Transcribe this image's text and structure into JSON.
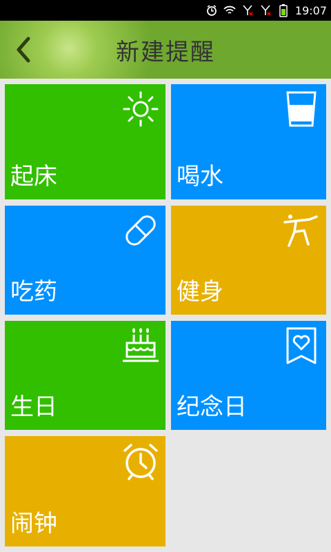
{
  "status": {
    "time": "19:07",
    "icons": [
      "alarm-icon",
      "wifi-icon",
      "signal-1-icon",
      "signal-2-icon",
      "battery-icon"
    ]
  },
  "header": {
    "title": "新建提醒",
    "back_icon": "chevron-left-icon"
  },
  "tiles": [
    {
      "label": "起床",
      "icon": "sun-icon",
      "color": "#31bf00"
    },
    {
      "label": "喝水",
      "icon": "cup-icon",
      "color": "#0091ff"
    },
    {
      "label": "吃药",
      "icon": "pill-icon",
      "color": "#0091ff"
    },
    {
      "label": "健身",
      "icon": "exercise-icon",
      "color": "#e7b000"
    },
    {
      "label": "生日",
      "icon": "cake-icon",
      "color": "#31bf00"
    },
    {
      "label": "纪念日",
      "icon": "heart-bookmark-icon",
      "color": "#0091ff"
    },
    {
      "label": "闹钟",
      "icon": "alarm-clock-icon",
      "color": "#e7b000"
    }
  ]
}
